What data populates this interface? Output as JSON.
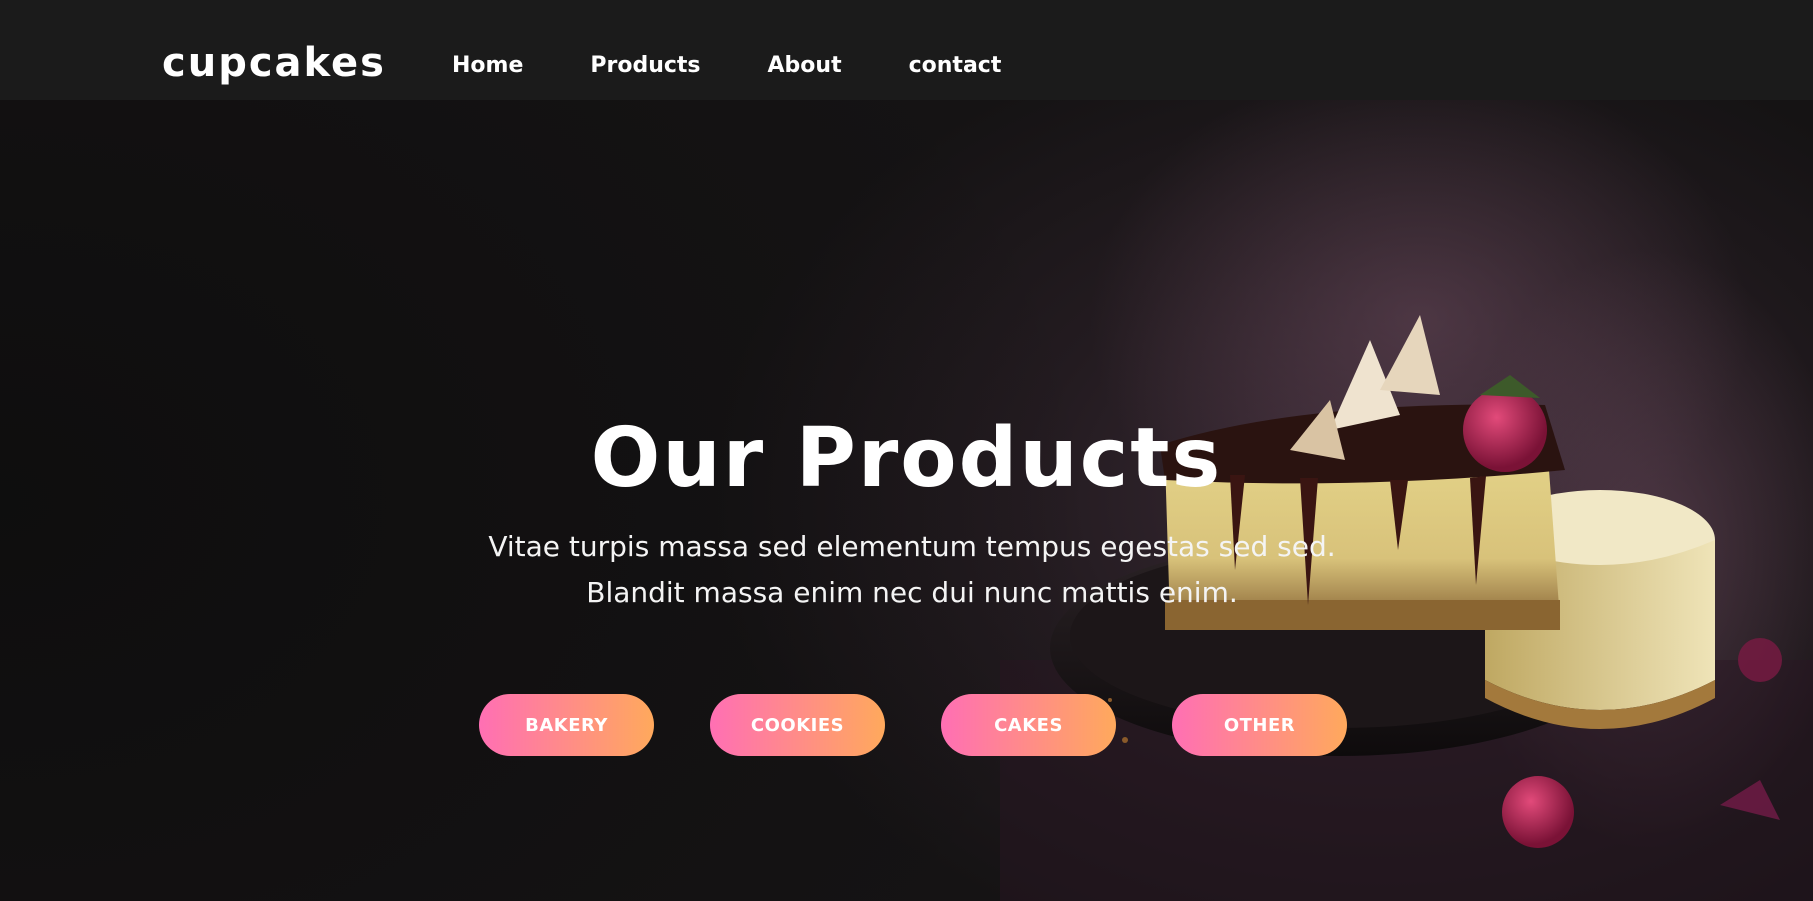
{
  "header": {
    "brand": "cupcakes",
    "nav": [
      {
        "label": "Home"
      },
      {
        "label": "Products"
      },
      {
        "label": "About"
      },
      {
        "label": "contact"
      }
    ]
  },
  "hero": {
    "title": "Our Products",
    "description": "Vitae turpis massa sed elementum tempus egestas sed sed. Blandit massa enim nec dui nunc mattis enim.",
    "categories": [
      {
        "label": "BAKERY"
      },
      {
        "label": "COOKIES"
      },
      {
        "label": "CAKES"
      },
      {
        "label": "OTHER"
      }
    ]
  },
  "colors": {
    "header_bg": "#1b1b1b",
    "hero_bg": "#141213",
    "button_gradient_start": "#ff6fb4",
    "button_gradient_end": "#ffa95c",
    "text": "#ffffff"
  },
  "icons": {
    "hero_image": "cheesecake-slice-image"
  }
}
